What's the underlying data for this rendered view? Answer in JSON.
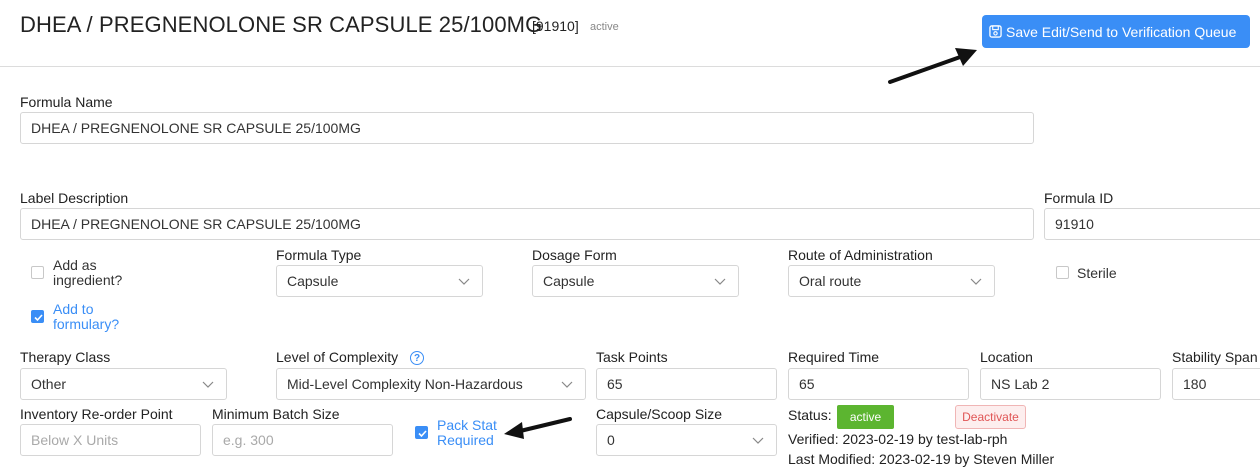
{
  "header": {
    "title": "DHEA / PREGNENOLONE SR CAPSULE 25/100MG",
    "formula_id": "[91910]",
    "status": "active",
    "save_button": "Save Edit/Send to Verification Queue"
  },
  "form": {
    "formula_name": {
      "label": "Formula Name",
      "value": "DHEA / PREGNENOLONE SR CAPSULE   25/100MG"
    },
    "label_description": {
      "label": "Label Description",
      "value": "DHEA / PREGNENOLONE SR CAPSULE   25/100MG"
    },
    "formula_id": {
      "label": "Formula ID",
      "value": "91910"
    },
    "add_as_ingredient": {
      "label_line1": "Add as",
      "label_line2": "ingredient?",
      "checked": false
    },
    "add_to_formulary": {
      "label_line1": "Add to",
      "label_line2": "formulary?",
      "checked": true
    },
    "formula_type": {
      "label": "Formula Type",
      "value": "Capsule"
    },
    "dosage_form": {
      "label": "Dosage Form",
      "value": "Capsule"
    },
    "route": {
      "label": "Route of Administration",
      "value": "Oral route"
    },
    "sterile": {
      "label": "Sterile",
      "checked": false
    },
    "therapy_class": {
      "label": "Therapy Class",
      "value": "Other"
    },
    "complexity": {
      "label": "Level of Complexity",
      "value": "Mid-Level Complexity Non-Hazardous",
      "help": "?"
    },
    "task_points": {
      "label": "Task Points",
      "value": "65"
    },
    "required_time": {
      "label": "Required Time",
      "value": "65"
    },
    "location": {
      "label": "Location",
      "value": "NS Lab 2"
    },
    "stability_span": {
      "label": "Stability Span",
      "value": "180"
    },
    "reorder_point": {
      "label": "Inventory Re-order Point",
      "placeholder": "Below X Units"
    },
    "min_batch": {
      "label": "Minimum Batch Size",
      "placeholder": "e.g. 300"
    },
    "pack_stat": {
      "label_line1": "Pack Stat",
      "label_line2": "Required",
      "checked": true
    },
    "capsule_size": {
      "label": "Capsule/Scoop Size",
      "value": "0"
    }
  },
  "status_panel": {
    "status_label": "Status:",
    "status_badge": "active",
    "deactivate": "Deactivate",
    "verified": "Verified: 2023-02-19 by test-lab-rph",
    "last_modified": "Last Modified: 2023-02-19 by Steven Miller"
  },
  "colors": {
    "accent": "#3a8ef6",
    "success": "#5cb530",
    "danger": "#e05555"
  },
  "icons": {
    "save": "save-icon",
    "chevron": "chevron-down-icon",
    "check": "check-icon",
    "arrow": "annotation-arrow"
  }
}
